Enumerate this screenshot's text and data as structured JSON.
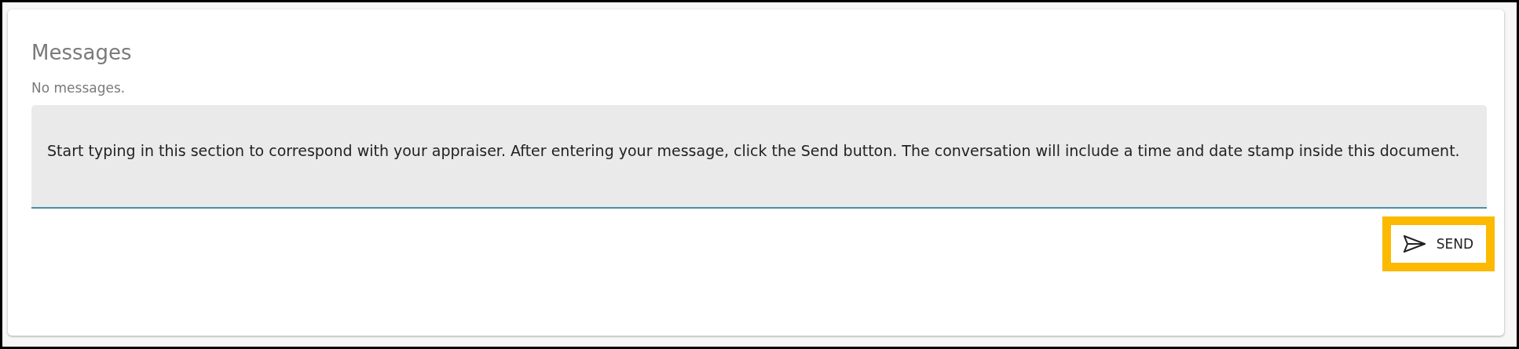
{
  "panel": {
    "title": "Messages",
    "status": "No messages."
  },
  "message_field": {
    "placeholder": "Start typing in this section to correspond with your appraiser. After entering your message, click the Send button. The conversation will include a time and date stamp inside this document."
  },
  "send_button": {
    "label": "SEND",
    "highlighted": true
  }
}
